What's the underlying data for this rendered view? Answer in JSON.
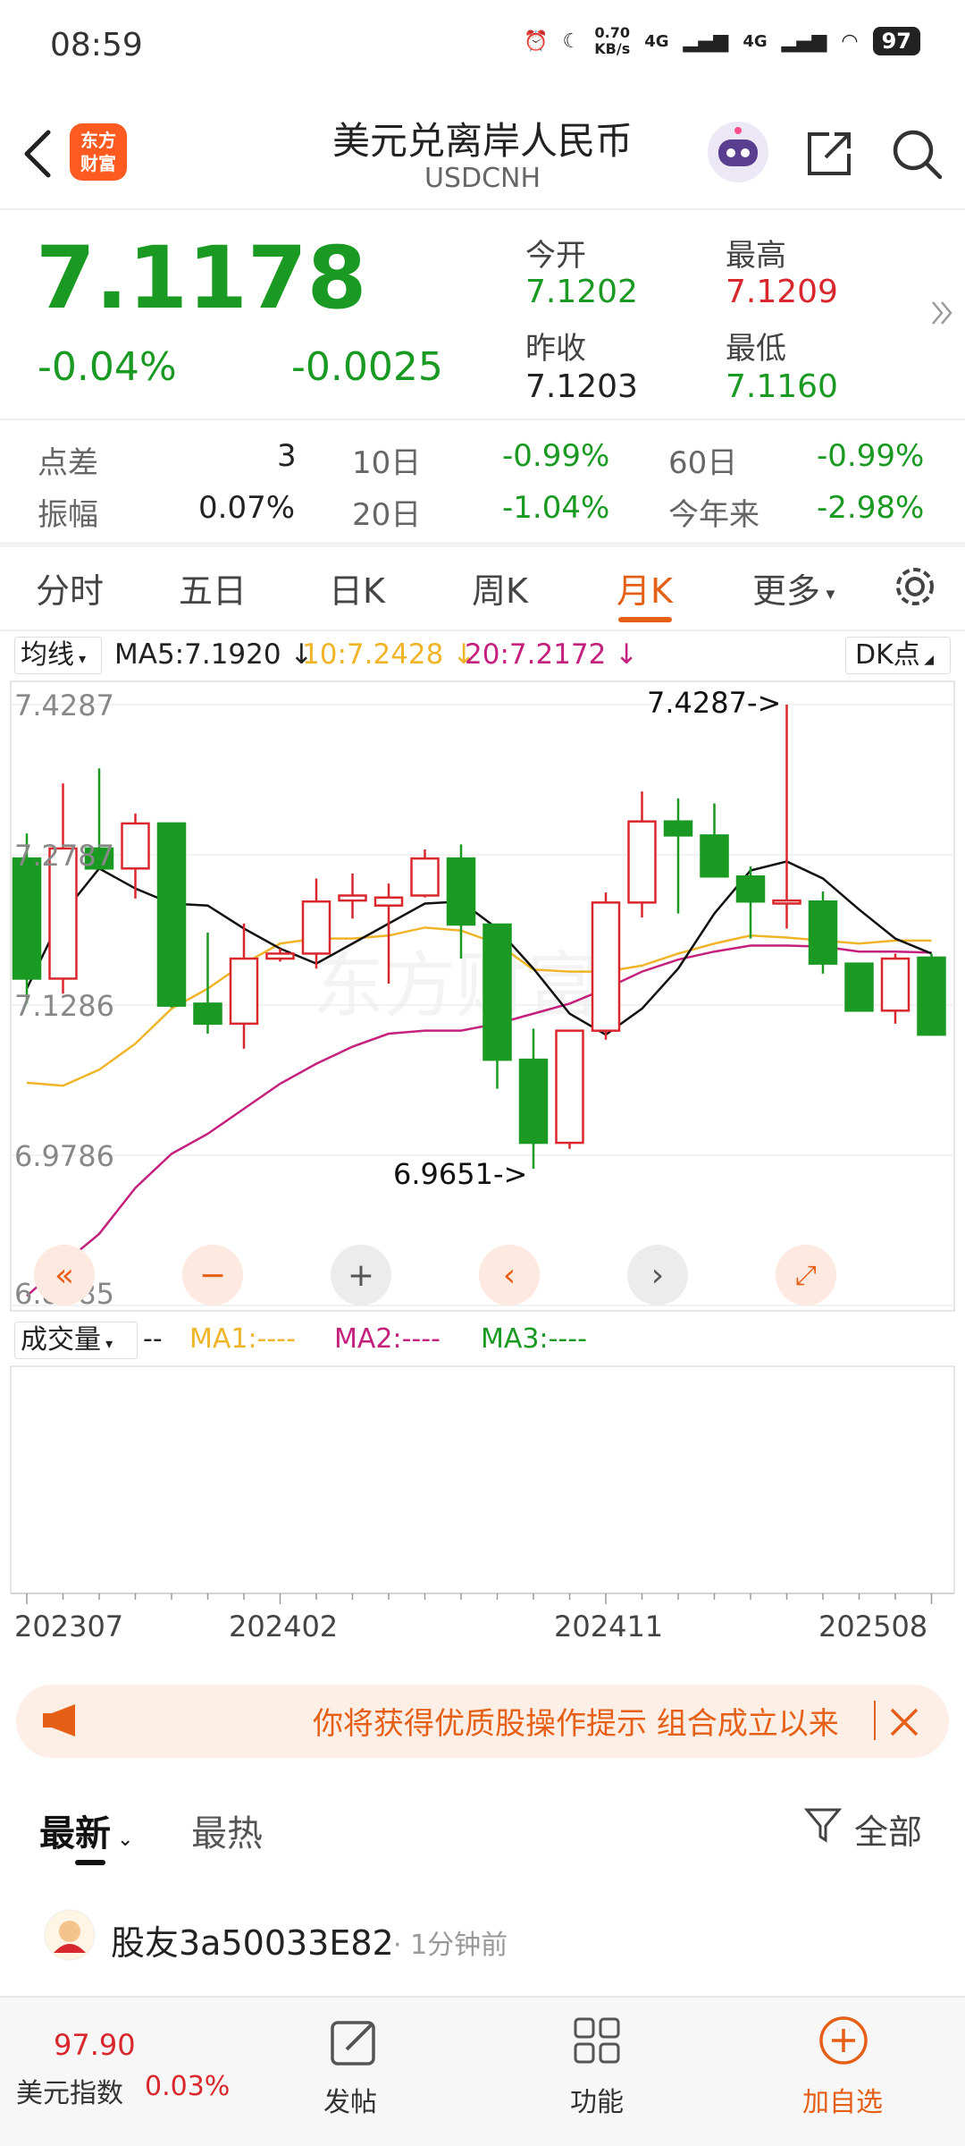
{
  "status": {
    "time": "08:59",
    "net_speed": "0.70",
    "net_unit": "KB/s",
    "sig1": "4G",
    "sig2": "4G",
    "battery": "97"
  },
  "header": {
    "logo_line1": "东方",
    "logo_line2": "财富",
    "title": "美元兑离岸人民币",
    "symbol": "USDCNH"
  },
  "quote": {
    "price": "7.1178",
    "change_pct": "-0.04%",
    "change": "-0.0025",
    "open_label": "今开",
    "open": "7.1202",
    "high_label": "最高",
    "high": "7.1209",
    "prev_close_label": "昨收",
    "prev_close": "7.1203",
    "low_label": "最低",
    "low": "7.1160"
  },
  "stats": {
    "spread_label": "点差",
    "spread": "3",
    "amplitude_label": "振幅",
    "amplitude": "0.07%",
    "d10_label": "10日",
    "d10": "-0.99%",
    "d20_label": "20日",
    "d20": "-1.04%",
    "d60_label": "60日",
    "d60": "-0.99%",
    "ytd_label": "今年来",
    "ytd": "-2.98%"
  },
  "tabs": [
    "分时",
    "五日",
    "日K",
    "周K",
    "月K",
    "更多"
  ],
  "active_tab": "月K",
  "indicator": {
    "selector": "均线",
    "ma5": "MA5:7.1920 ↓",
    "ma10": "10:7.2428 ↓",
    "ma20": "20:7.2172 ↓",
    "dk": "DK点"
  },
  "volume": {
    "selector": "成交量",
    "dash": "--",
    "ma1": "MA1:----",
    "ma2": "MA2:----",
    "ma3": "MA3:----"
  },
  "colors": {
    "up": "#d8282d",
    "down": "#1a9a22",
    "ma5": "#111111",
    "ma10": "#f0b429",
    "ma20": "#c4207e",
    "accent": "#e65f16"
  },
  "chart_data": {
    "type": "candlestick",
    "title": "",
    "ylim": [
      6.8285,
      7.4287
    ],
    "y_ticks": [
      "7.4287",
      "7.2787",
      "7.1286",
      "6.9786",
      "6.8285"
    ],
    "x_ticks": [
      "202307",
      "202402",
      "202411",
      "202508"
    ],
    "annotations": {
      "max": "7.4287->",
      "min": "6.9651->"
    },
    "candles": [
      {
        "o": 7.275,
        "h": 7.3,
        "l": 7.13,
        "c": 7.155
      },
      {
        "o": 7.155,
        "h": 7.35,
        "l": 7.14,
        "c": 7.285
      },
      {
        "o": 7.285,
        "h": 7.365,
        "l": 7.265,
        "c": 7.265
      },
      {
        "o": 7.265,
        "h": 7.32,
        "l": 7.235,
        "c": 7.31
      },
      {
        "o": 7.31,
        "h": 7.31,
        "l": 7.126,
        "c": 7.128
      },
      {
        "o": 7.13,
        "h": 7.201,
        "l": 7.1,
        "c": 7.11
      },
      {
        "o": 7.11,
        "h": 7.21,
        "l": 7.085,
        "c": 7.175
      },
      {
        "o": 7.175,
        "h": 7.185,
        "l": 7.172,
        "c": 7.18
      },
      {
        "o": 7.18,
        "h": 7.255,
        "l": 7.165,
        "c": 7.232
      },
      {
        "o": 7.233,
        "h": 7.26,
        "l": 7.215,
        "c": 7.238
      },
      {
        "o": 7.228,
        "h": 7.25,
        "l": 7.15,
        "c": 7.236
      },
      {
        "o": 7.238,
        "h": 7.284,
        "l": 7.236,
        "c": 7.275
      },
      {
        "o": 7.275,
        "h": 7.289,
        "l": 7.175,
        "c": 7.209
      },
      {
        "o": 7.209,
        "h": 7.209,
        "l": 7.045,
        "c": 7.074
      },
      {
        "o": 7.074,
        "h": 7.105,
        "l": 6.9651,
        "c": 6.991
      },
      {
        "o": 6.991,
        "h": 7.103,
        "l": 6.985,
        "c": 7.103
      },
      {
        "o": 7.103,
        "h": 7.241,
        "l": 7.094,
        "c": 7.231
      },
      {
        "o": 7.231,
        "h": 7.342,
        "l": 7.216,
        "c": 7.312
      },
      {
        "o": 7.312,
        "h": 7.335,
        "l": 7.22,
        "c": 7.298
      },
      {
        "o": 7.298,
        "h": 7.33,
        "l": 7.256,
        "c": 7.257
      },
      {
        "o": 7.257,
        "h": 7.267,
        "l": 7.195,
        "c": 7.232
      },
      {
        "o": 7.23,
        "h": 7.4287,
        "l": 7.205,
        "c": 7.233
      },
      {
        "o": 7.232,
        "h": 7.242,
        "l": 7.16,
        "c": 7.17
      },
      {
        "o": 7.17,
        "h": 7.17,
        "l": 7.131,
        "c": 7.123
      },
      {
        "o": 7.123,
        "h": 7.18,
        "l": 7.11,
        "c": 7.175
      },
      {
        "o": 7.176,
        "h": 7.18,
        "l": 7.098,
        "c": 7.099
      }
    ],
    "ma5": [
      7.145,
      7.22,
      7.265,
      7.245,
      7.23,
      7.228,
      7.205,
      7.185,
      7.17,
      7.19,
      7.21,
      7.23,
      7.232,
      7.205,
      7.165,
      7.12,
      7.099,
      7.125,
      7.165,
      7.22,
      7.263,
      7.272,
      7.255,
      7.224,
      7.195,
      7.18
    ],
    "ma10": [
      7.051,
      7.048,
      7.064,
      7.09,
      7.125,
      7.145,
      7.17,
      7.19,
      7.195,
      7.195,
      7.198,
      7.206,
      7.203,
      7.19,
      7.164,
      7.162,
      7.162,
      7.168,
      7.18,
      7.19,
      7.198,
      7.196,
      7.193,
      7.19,
      7.193,
      7.193
    ],
    "ma20": [
      6.838,
      6.87,
      6.9,
      6.946,
      6.98,
      7.0,
      7.025,
      7.05,
      7.07,
      7.087,
      7.1,
      7.103,
      7.103,
      7.11,
      7.12,
      7.13,
      7.145,
      7.162,
      7.174,
      7.182,
      7.188,
      7.188,
      7.187,
      7.182,
      7.182,
      7.181
    ]
  },
  "banner": {
    "text": "你将获得优质股操作提示 组合成立以来"
  },
  "comments": {
    "tab_latest": "最新",
    "tab_hot": "最热",
    "filter": "全部",
    "user": "股友3a50033E82",
    "time": "· 1分钟前"
  },
  "bottom": {
    "index_value": "97.90",
    "index_name": "美元指数",
    "index_change": "0.03%",
    "post": "发帖",
    "func": "功能",
    "add": "加自选"
  }
}
